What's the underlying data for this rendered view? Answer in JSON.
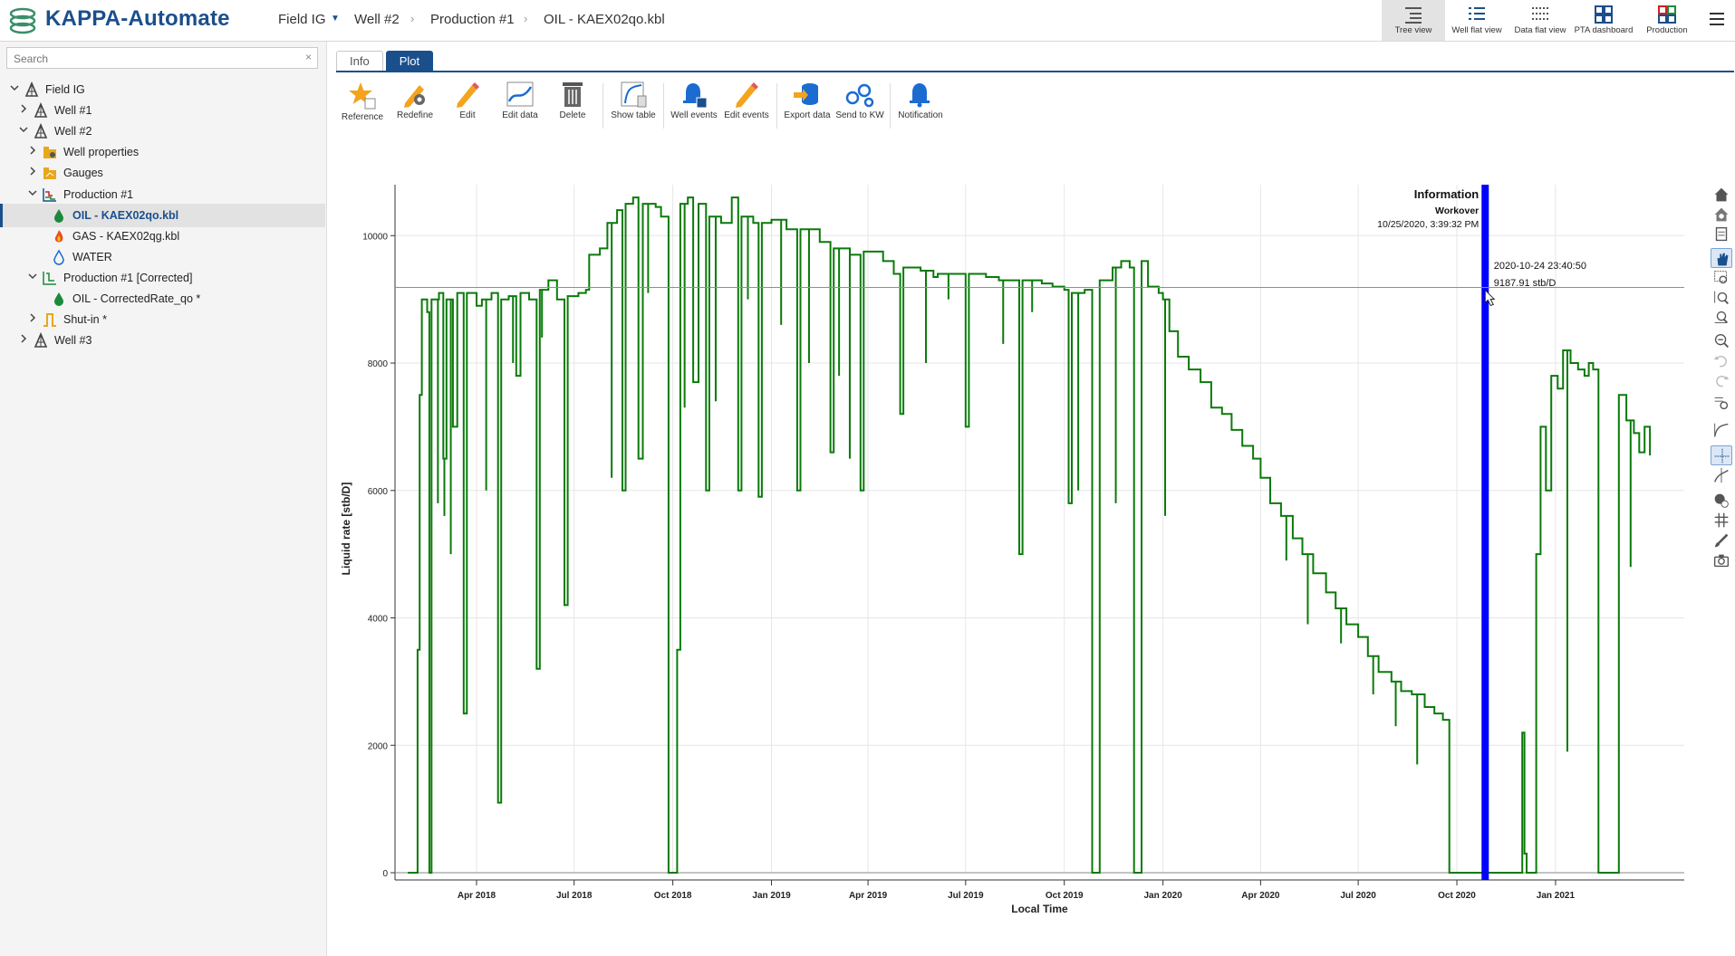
{
  "app": {
    "title": "KAPPA-Automate"
  },
  "breadcrumb": [
    "Field IG",
    "Well #2",
    "Production #1",
    "OIL - KAEX02qo.kbl"
  ],
  "views": [
    {
      "label": "Tree view",
      "icon": "tree-view-icon",
      "active": true
    },
    {
      "label": "Well flat view",
      "icon": "well-flat-view-icon",
      "active": false
    },
    {
      "label": "Data flat view",
      "icon": "data-flat-view-icon",
      "active": false
    },
    {
      "label": "PTA dashboard",
      "icon": "pta-dashboard-icon",
      "active": false
    },
    {
      "label": "Production",
      "icon": "production-icon",
      "active": false
    }
  ],
  "search": {
    "placeholder": "Search",
    "clear": "×"
  },
  "tree": [
    {
      "label": "Field IG",
      "icon": "field-icon",
      "expanded": true,
      "depth": 0,
      "selected": false
    },
    {
      "label": "Well #1",
      "icon": "well-icon",
      "expanded": false,
      "depth": 1,
      "selected": false
    },
    {
      "label": "Well #2",
      "icon": "well-icon",
      "expanded": true,
      "depth": 1,
      "selected": false
    },
    {
      "label": "Well properties",
      "icon": "well-properties-icon",
      "expanded": false,
      "depth": 2,
      "selected": false
    },
    {
      "label": "Gauges",
      "icon": "gauges-folder-icon",
      "expanded": false,
      "depth": 2,
      "selected": false
    },
    {
      "label": "Production #1",
      "icon": "production-icon",
      "expanded": true,
      "depth": 2,
      "selected": false
    },
    {
      "label": "OIL - KAEX02qo.kbl",
      "icon": "oil-drop-icon",
      "leaf": true,
      "depth": 3,
      "selected": true
    },
    {
      "label": "GAS - KAEX02qg.kbl",
      "icon": "gas-flame-icon",
      "leaf": true,
      "depth": 3,
      "selected": false
    },
    {
      "label": "WATER",
      "icon": "water-drop-icon",
      "leaf": true,
      "depth": 3,
      "selected": false
    },
    {
      "label": "Production #1 [Corrected]",
      "icon": "corrected-production-icon",
      "expanded": true,
      "depth": 2,
      "selected": false
    },
    {
      "label": "OIL - CorrectedRate_qo *",
      "icon": "oil-drop-icon",
      "leaf": true,
      "depth": 3,
      "selected": false
    },
    {
      "label": "Shut-in *",
      "icon": "shut-in-icon",
      "expanded": false,
      "depth": 2,
      "selected": false
    },
    {
      "label": "Well #3",
      "icon": "well-icon",
      "expanded": false,
      "depth": 1,
      "selected": false
    }
  ],
  "tabs": [
    {
      "label": "Info",
      "active": false
    },
    {
      "label": "Plot",
      "active": true
    }
  ],
  "toolbar": [
    {
      "label": "Reference",
      "icon": "reference-star-icon"
    },
    {
      "label": "Redefine",
      "icon": "redefine-icon"
    },
    {
      "label": "Edit",
      "icon": "edit-pencil-icon"
    },
    {
      "label": "Edit data",
      "icon": "edit-data-icon"
    },
    {
      "label": "Delete",
      "icon": "delete-trash-icon"
    },
    {
      "label": "Show table",
      "icon": "show-table-icon"
    },
    {
      "label": "Well events",
      "icon": "well-events-bell-icon"
    },
    {
      "label": "Edit events",
      "icon": "edit-events-icon"
    },
    {
      "label": "Export data",
      "icon": "export-data-icon"
    },
    {
      "label": "Send to KW",
      "icon": "send-to-kw-icon"
    },
    {
      "label": "Notification",
      "icon": "notification-bell-icon"
    }
  ],
  "right_tools": [
    "home-icon",
    "home-alt-icon",
    "list-icon",
    "pan-hand-icon",
    "zoom-box-icon",
    "zoom-x-icon",
    "zoom-y-icon",
    "zoom-out-icon",
    "undo-icon",
    "redo-icon",
    "zoom-fit-icon",
    "line-tool-icon",
    "crosshair-icon",
    "cursor-tool-icon",
    "marker-icon",
    "grid-icon",
    "brush-icon",
    "camera-icon"
  ],
  "info_box": {
    "title": "Information",
    "event": "Workover",
    "timestamp": "10/25/2020, 3:39:32 PM"
  },
  "cursor_readout": {
    "date": "2020-10-24 23:40:50",
    "value": "9187.91 stb/D",
    "y": 9187.91
  },
  "colors": {
    "accent": "#1b4f8c",
    "series": "#0a7a0a",
    "event_band": "#0000ff"
  },
  "chart_data": {
    "type": "line",
    "xlabel": "Local Time",
    "ylabel": "Liquid rate [stb/D]",
    "xlim": [
      "2018-01-15",
      "2021-05-01"
    ],
    "ylim": [
      0,
      10800
    ],
    "yticks": [
      0,
      2000,
      4000,
      6000,
      8000,
      10000
    ],
    "xticks": [
      {
        "date": "2018-04-01",
        "label": "Apr 2018"
      },
      {
        "date": "2018-07-01",
        "label": "Jul 2018"
      },
      {
        "date": "2018-10-01",
        "label": "Oct 2018"
      },
      {
        "date": "2019-01-01",
        "label": "Jan 2019"
      },
      {
        "date": "2019-04-01",
        "label": "Apr 2019"
      },
      {
        "date": "2019-07-01",
        "label": "Jul 2019"
      },
      {
        "date": "2019-10-01",
        "label": "Oct 2019"
      },
      {
        "date": "2020-01-01",
        "label": "Jan 2020"
      },
      {
        "date": "2020-04-01",
        "label": "Apr 2020"
      },
      {
        "date": "2020-07-01",
        "label": "Jul 2020"
      },
      {
        "date": "2020-10-01",
        "label": "Oct 2020"
      },
      {
        "date": "2021-01-01",
        "label": "Jan 2021"
      }
    ],
    "event_band": {
      "start": "2020-10-24",
      "end": "2020-10-27",
      "label": "Workover"
    },
    "series": [
      {
        "name": "OIL - KAEX02qo.kbl",
        "points": [
          [
            "2018-01-27",
            0
          ],
          [
            "2018-02-03",
            0
          ],
          [
            "2018-02-05",
            3500
          ],
          [
            "2018-02-07",
            7500
          ],
          [
            "2018-02-09",
            9000
          ],
          [
            "2018-02-14",
            8800
          ],
          [
            "2018-02-16",
            0
          ],
          [
            "2018-02-18",
            9000
          ],
          [
            "2018-02-25",
            9100
          ],
          [
            "2018-03-01",
            6500
          ],
          [
            "2018-03-04",
            9000
          ],
          [
            "2018-03-10",
            7000
          ],
          [
            "2018-03-14",
            9100
          ],
          [
            "2018-03-20",
            2500
          ],
          [
            "2018-03-23",
            9100
          ],
          [
            "2018-04-01",
            8900
          ],
          [
            "2018-04-06",
            9000
          ],
          [
            "2018-04-15",
            9100
          ],
          [
            "2018-04-21",
            1100
          ],
          [
            "2018-04-24",
            9000
          ],
          [
            "2018-05-01",
            9050
          ],
          [
            "2018-05-08",
            7800
          ],
          [
            "2018-05-12",
            9100
          ],
          [
            "2018-05-20",
            9000
          ],
          [
            "2018-05-27",
            3200
          ],
          [
            "2018-05-30",
            9150
          ],
          [
            "2018-06-07",
            9300
          ],
          [
            "2018-06-15",
            9000
          ],
          [
            "2018-06-22",
            4200
          ],
          [
            "2018-06-25",
            9050
          ],
          [
            "2018-07-05",
            9100
          ],
          [
            "2018-07-12",
            9150
          ],
          [
            "2018-07-15",
            9700
          ],
          [
            "2018-07-25",
            9800
          ],
          [
            "2018-08-01",
            10200
          ],
          [
            "2018-08-10",
            10400
          ],
          [
            "2018-08-15",
            6000
          ],
          [
            "2018-08-18",
            10500
          ],
          [
            "2018-08-25",
            10600
          ],
          [
            "2018-08-30",
            6500
          ],
          [
            "2018-09-03",
            10500
          ],
          [
            "2018-09-15",
            10450
          ],
          [
            "2018-09-20",
            10300
          ],
          [
            "2018-09-27",
            0
          ],
          [
            "2018-10-03",
            0
          ],
          [
            "2018-10-05",
            3500
          ],
          [
            "2018-10-08",
            10500
          ],
          [
            "2018-10-15",
            10600
          ],
          [
            "2018-10-20",
            7700
          ],
          [
            "2018-10-25",
            10500
          ],
          [
            "2018-11-01",
            6000
          ],
          [
            "2018-11-04",
            10300
          ],
          [
            "2018-11-15",
            10200
          ],
          [
            "2018-11-25",
            10600
          ],
          [
            "2018-12-01",
            6000
          ],
          [
            "2018-12-04",
            10300
          ],
          [
            "2018-12-15",
            10200
          ],
          [
            "2018-12-20",
            5900
          ],
          [
            "2018-12-23",
            10200
          ],
          [
            "2019-01-01",
            10250
          ],
          [
            "2019-01-15",
            10100
          ],
          [
            "2019-01-25",
            6000
          ],
          [
            "2019-01-28",
            10100
          ],
          [
            "2019-02-15",
            9900
          ],
          [
            "2019-02-25",
            6600
          ],
          [
            "2019-02-28",
            9800
          ],
          [
            "2019-03-15",
            9700
          ],
          [
            "2019-03-25",
            6000
          ],
          [
            "2019-03-28",
            9750
          ],
          [
            "2019-04-15",
            9600
          ],
          [
            "2019-04-25",
            9400
          ],
          [
            "2019-05-01",
            7200
          ],
          [
            "2019-05-04",
            9500
          ],
          [
            "2019-05-20",
            9450
          ],
          [
            "2019-06-01",
            9350
          ],
          [
            "2019-06-05",
            9400
          ],
          [
            "2019-06-20",
            9400
          ],
          [
            "2019-07-01",
            7000
          ],
          [
            "2019-07-04",
            9400
          ],
          [
            "2019-07-20",
            9350
          ],
          [
            "2019-08-01",
            9300
          ],
          [
            "2019-08-15",
            9300
          ],
          [
            "2019-08-20",
            5000
          ],
          [
            "2019-08-23",
            9300
          ],
          [
            "2019-09-10",
            9250
          ],
          [
            "2019-09-20",
            9200
          ],
          [
            "2019-10-01",
            9150
          ],
          [
            "2019-10-05",
            5800
          ],
          [
            "2019-10-08",
            9100
          ],
          [
            "2019-10-20",
            9150
          ],
          [
            "2019-10-27",
            0
          ],
          [
            "2019-11-01",
            0
          ],
          [
            "2019-11-03",
            9300
          ],
          [
            "2019-11-15",
            9500
          ],
          [
            "2019-11-23",
            9600
          ],
          [
            "2019-12-01",
            9500
          ],
          [
            "2019-12-05",
            0
          ],
          [
            "2019-12-10",
            0
          ],
          [
            "2019-12-12",
            9600
          ],
          [
            "2019-12-18",
            9200
          ],
          [
            "2019-12-28",
            9100
          ],
          [
            "2020-01-01",
            9000
          ],
          [
            "2020-01-07",
            8500
          ],
          [
            "2020-01-15",
            8100
          ],
          [
            "2020-01-25",
            7900
          ],
          [
            "2020-02-05",
            7700
          ],
          [
            "2020-02-15",
            7300
          ],
          [
            "2020-02-25",
            7200
          ],
          [
            "2020-03-05",
            6950
          ],
          [
            "2020-03-15",
            6700
          ],
          [
            "2020-03-25",
            6500
          ],
          [
            "2020-04-01",
            6200
          ],
          [
            "2020-04-10",
            5800
          ],
          [
            "2020-04-20",
            5600
          ],
          [
            "2020-05-01",
            5250
          ],
          [
            "2020-05-10",
            5000
          ],
          [
            "2020-05-20",
            4700
          ],
          [
            "2020-06-01",
            4400
          ],
          [
            "2020-06-10",
            4150
          ],
          [
            "2020-06-20",
            3900
          ],
          [
            "2020-07-01",
            3700
          ],
          [
            "2020-07-10",
            3400
          ],
          [
            "2020-07-20",
            3150
          ],
          [
            "2020-08-01",
            3000
          ],
          [
            "2020-08-10",
            2850
          ],
          [
            "2020-08-20",
            2800
          ],
          [
            "2020-09-01",
            2600
          ],
          [
            "2020-09-10",
            2500
          ],
          [
            "2020-09-18",
            2400
          ],
          [
            "2020-09-24",
            0
          ],
          [
            "2020-10-24",
            0
          ],
          [
            "2020-10-27",
            0
          ],
          [
            "2020-11-25",
            0
          ],
          [
            "2020-12-01",
            2200
          ],
          [
            "2020-12-03",
            300
          ],
          [
            "2020-12-05",
            0
          ],
          [
            "2020-12-10",
            0
          ],
          [
            "2020-12-14",
            5000
          ],
          [
            "2020-12-18",
            7000
          ],
          [
            "2020-12-23",
            6000
          ],
          [
            "2020-12-28",
            7800
          ],
          [
            "2021-01-03",
            7600
          ],
          [
            "2021-01-08",
            8200
          ],
          [
            "2021-01-15",
            8000
          ],
          [
            "2021-01-22",
            7900
          ],
          [
            "2021-01-28",
            7800
          ],
          [
            "2021-02-01",
            8000
          ],
          [
            "2021-02-05",
            7900
          ],
          [
            "2021-02-10",
            0
          ],
          [
            "2021-02-25",
            0
          ],
          [
            "2021-03-01",
            7500
          ],
          [
            "2021-03-08",
            7100
          ],
          [
            "2021-03-15",
            6900
          ],
          [
            "2021-03-20",
            6600
          ],
          [
            "2021-03-25",
            7000
          ],
          [
            "2021-03-30",
            6550
          ]
        ],
        "dips": [
          [
            "2018-02-24",
            5800
          ],
          [
            "2018-03-02",
            5600
          ],
          [
            "2018-03-08",
            5000
          ],
          [
            "2018-04-10",
            6000
          ],
          [
            "2018-05-05",
            8000
          ],
          [
            "2018-06-01",
            8400
          ],
          [
            "2018-08-05",
            6200
          ],
          [
            "2018-09-08",
            9100
          ],
          [
            "2018-10-12",
            7300
          ],
          [
            "2018-11-10",
            7400
          ],
          [
            "2018-12-10",
            9000
          ],
          [
            "2019-01-10",
            8600
          ],
          [
            "2019-02-05",
            8000
          ],
          [
            "2019-03-05",
            7800
          ],
          [
            "2019-03-15",
            6500
          ],
          [
            "2019-05-25",
            8000
          ],
          [
            "2019-06-15",
            9000
          ],
          [
            "2019-08-05",
            8300
          ],
          [
            "2019-09-01",
            8800
          ],
          [
            "2019-10-14",
            6000
          ],
          [
            "2019-11-18",
            5800
          ],
          [
            "2020-01-03",
            5600
          ],
          [
            "2020-04-25",
            4900
          ],
          [
            "2020-05-15",
            3900
          ],
          [
            "2020-06-15",
            3600
          ],
          [
            "2020-07-15",
            2800
          ],
          [
            "2020-08-05",
            2300
          ],
          [
            "2020-08-25",
            1700
          ],
          [
            "2021-01-12",
            1900
          ],
          [
            "2021-03-12",
            4800
          ]
        ]
      }
    ]
  }
}
